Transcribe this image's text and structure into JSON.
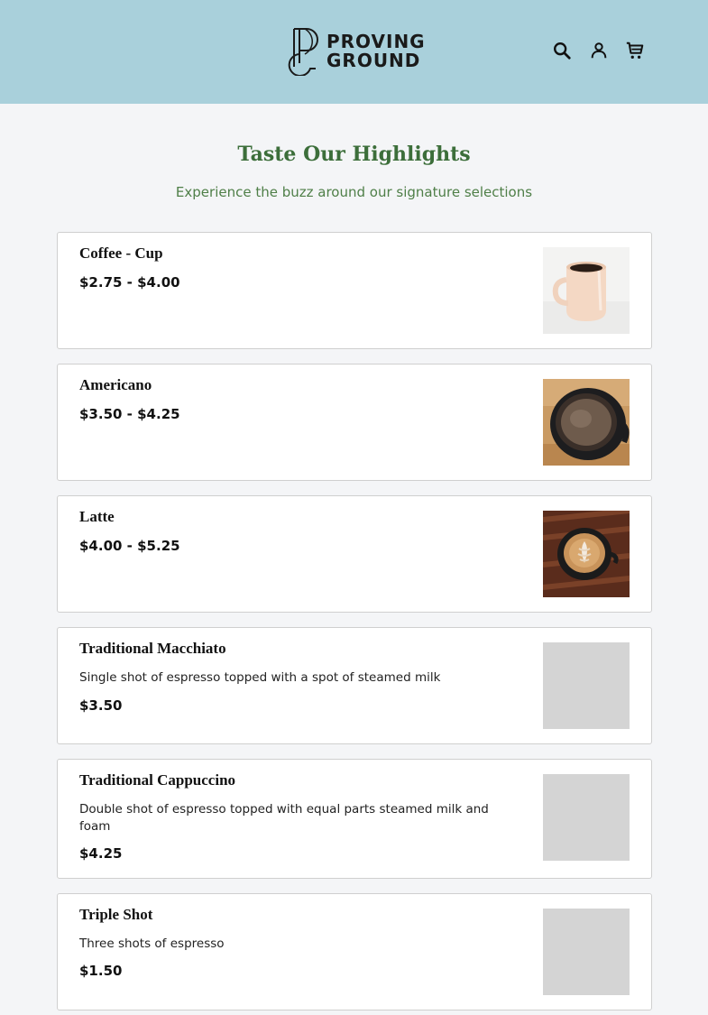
{
  "header": {
    "logo_line1": "PROVING",
    "logo_line2": "GROUND",
    "icons": [
      "search-icon",
      "account-icon",
      "cart-icon"
    ]
  },
  "section": {
    "title": "Taste Our Highlights",
    "subtitle": "Experience the buzz around our signature selections"
  },
  "products": [
    {
      "name": "Coffee - Cup",
      "description": "",
      "price": "$2.75 - $4.00",
      "image": "coffee-mug-photo"
    },
    {
      "name": "Americano",
      "description": "",
      "price": "$3.50 - $4.25",
      "image": "americano-photo"
    },
    {
      "name": "Latte",
      "description": "",
      "price": "$4.00 - $5.25",
      "image": "latte-art-photo"
    },
    {
      "name": "Traditional Macchiato",
      "description": "Single shot of espresso topped with a spot of steamed milk",
      "price": "$3.50",
      "image": "placeholder"
    },
    {
      "name": "Traditional Cappuccino",
      "description": "Double shot of espresso topped with equal parts steamed milk and foam",
      "price": "$4.25",
      "image": "placeholder"
    },
    {
      "name": "Triple Shot",
      "description": "Three shots of espresso",
      "price": "$1.50",
      "image": "placeholder"
    }
  ],
  "colors": {
    "header_bg": "#a9d0db",
    "accent_green": "#3c6e3a",
    "page_bg": "#f4f5f7"
  }
}
